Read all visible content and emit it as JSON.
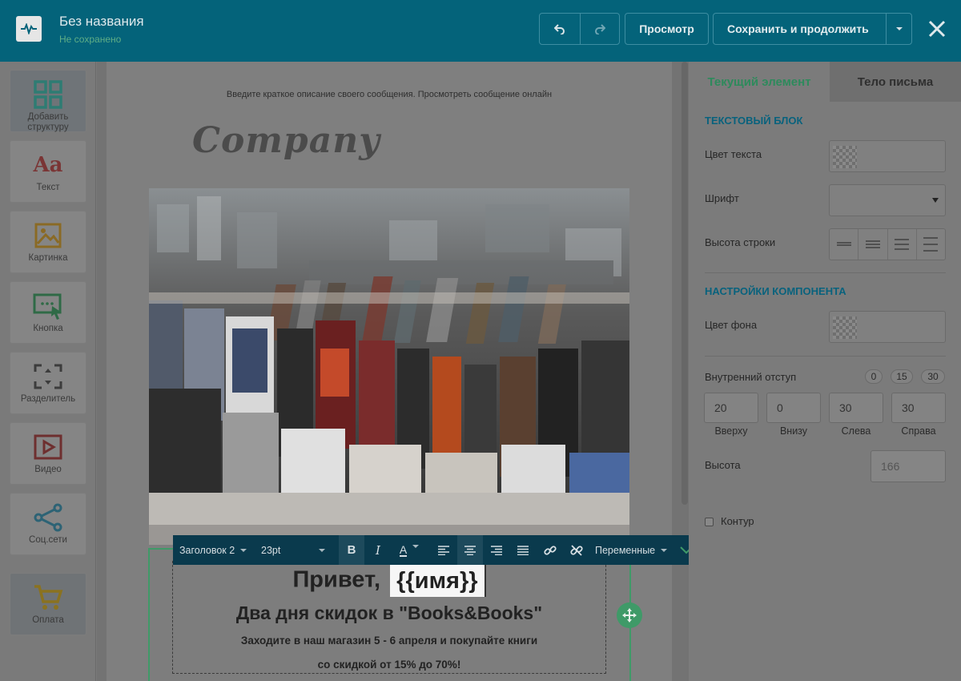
{
  "app": {
    "title": "Без названия",
    "status": "Не сохранено",
    "preview_label": "Просмотр",
    "save_label": "Сохранить и продолжить"
  },
  "tools": [
    {
      "label": "Добавить структуру",
      "icon": "grid-icon"
    },
    {
      "label": "Текст",
      "icon": "text-aa-icon"
    },
    {
      "label": "Картинка",
      "icon": "image-icon"
    },
    {
      "label": "Кнопка",
      "icon": "button-cursor-icon"
    },
    {
      "label": "Разделитель",
      "icon": "divider-icon"
    },
    {
      "label": "Видео",
      "icon": "video-icon"
    },
    {
      "label": "Соц.сети",
      "icon": "share-icon"
    },
    {
      "label": "Оплата",
      "icon": "cart-icon"
    }
  ],
  "canvas": {
    "preheader": "Введите краткое описание своего сообщения. Просмотреть сообщение онлайн",
    "logo_text": "Company",
    "greeting_prefix": "Привет,",
    "greeting_var": "{{имя}}",
    "heading": "Два дня скидок в \"Books&Books\"",
    "para1": "Заходите в наш магазин 5 - 6 апреля и покупайте книги",
    "para2": "со скидкой от 15% до 70%!"
  },
  "toolbar": {
    "style": "Заголовок 2",
    "size": "23pt",
    "variables": "Переменные"
  },
  "panel": {
    "tab_current": "Текущий элемент",
    "tab_body": "Тело письма",
    "section_text": "ТЕКСТОВЫЙ БЛОК",
    "text_color": "Цвет текста",
    "font": "Шрифт",
    "line_height": "Высота строки",
    "section_component": "НАСТРОЙКИ КОМПОНЕНТА",
    "bg_color": "Цвет фона",
    "padding": "Внутренний отступ",
    "presets": [
      "0",
      "15",
      "30"
    ],
    "paddings": [
      {
        "value": "20",
        "label": "Вверху"
      },
      {
        "value": "0",
        "label": "Внизу"
      },
      {
        "value": "30",
        "label": "Слева"
      },
      {
        "value": "30",
        "label": "Справа"
      }
    ],
    "height_label": "Высота",
    "height_value": "166",
    "outline_label": "Контур"
  },
  "colors": {
    "topbar": "#04637a",
    "accent_green": "#3f9a68",
    "section_blue": "#08627d"
  }
}
